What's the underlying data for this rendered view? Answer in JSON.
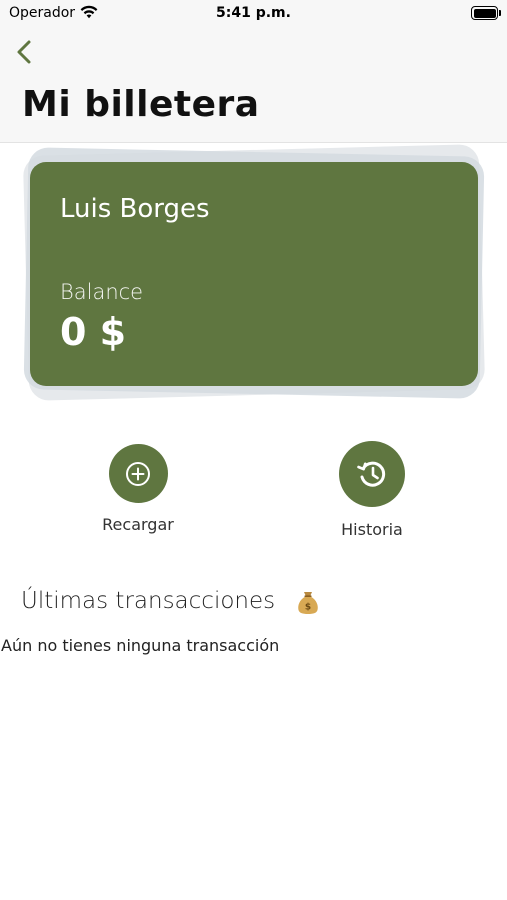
{
  "status_bar": {
    "carrier": "Operador",
    "time": "5:41 p.m.",
    "icons": [
      "wifi-icon",
      "battery-icon"
    ]
  },
  "header": {
    "back_icon": "chevron-left-icon",
    "title": "Mi billetera"
  },
  "wallet_card": {
    "owner_name": "Luis Borges",
    "balance_label": "Balance",
    "balance_value": "0 $",
    "color": "#5f7640"
  },
  "actions": [
    {
      "label": "Recargar",
      "icon": "plus-circle-icon"
    },
    {
      "label": "Historia",
      "icon": "history-icon"
    }
  ],
  "transactions": {
    "title": "Últimas transacciones",
    "title_icon": "money-bag-icon",
    "empty_message": "Aún no tienes ninguna transacción",
    "items": []
  }
}
